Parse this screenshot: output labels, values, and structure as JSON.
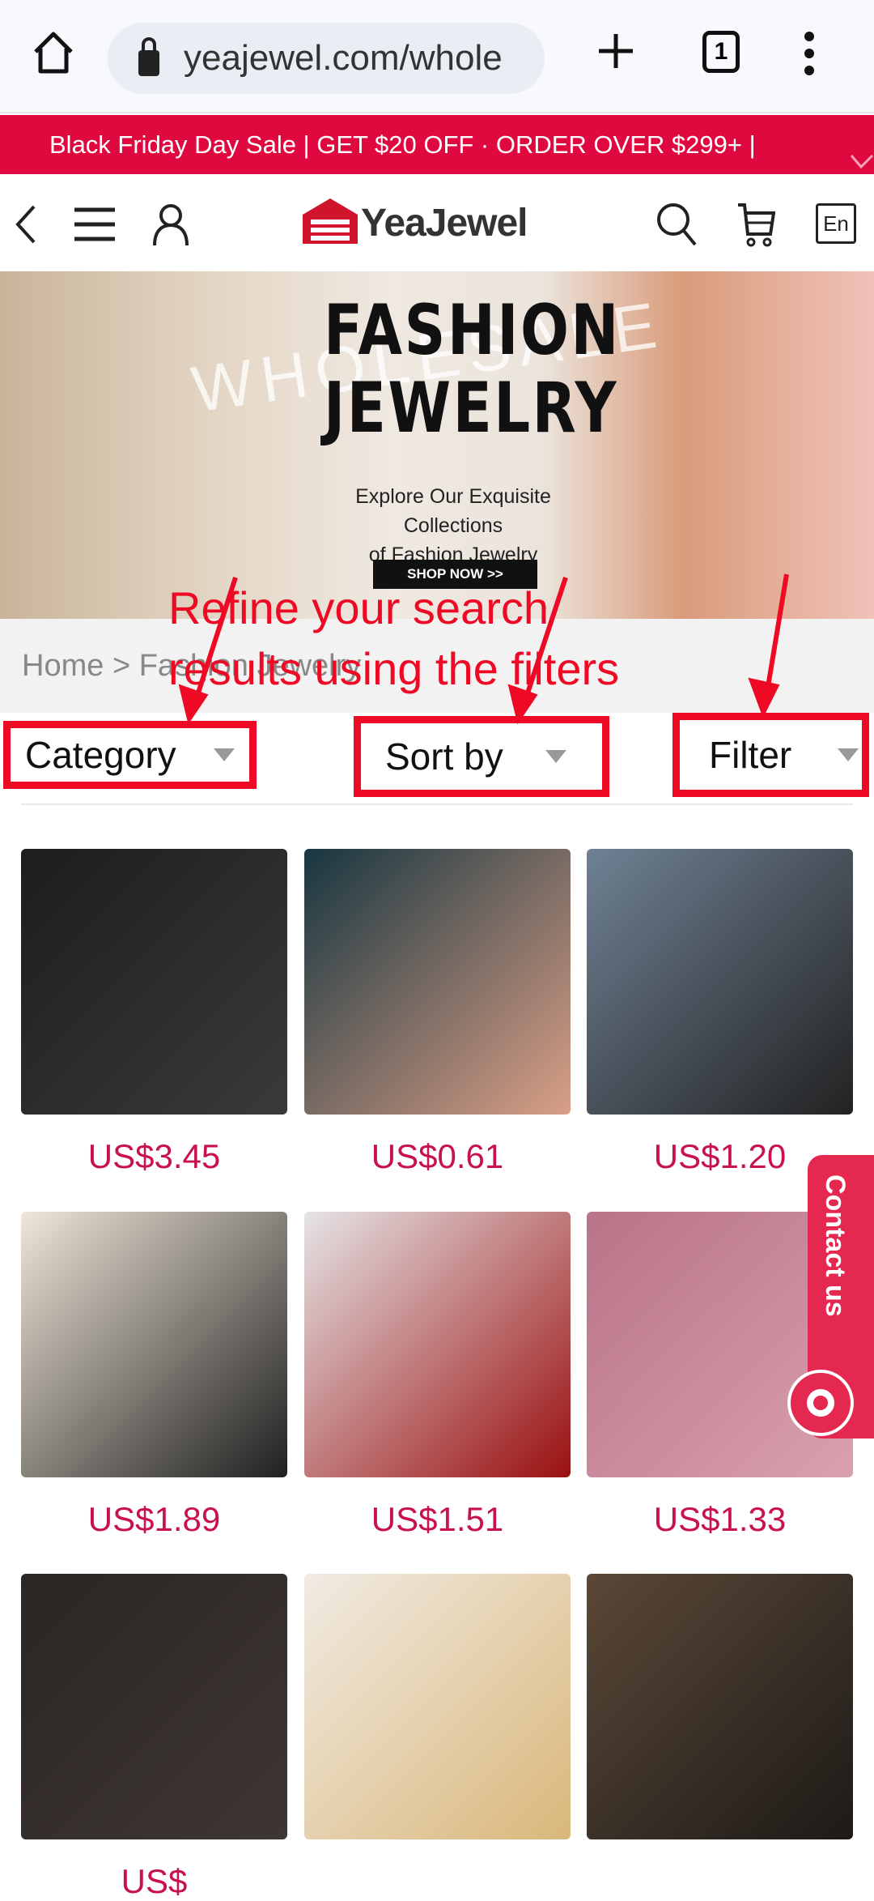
{
  "browser": {
    "url": "yeajewel.com/whole",
    "tab_count": "1"
  },
  "promo": {
    "text": "Black Friday Day Sale | GET $20 OFF  ·  ORDER OVER $299+ |"
  },
  "header": {
    "logo": "YeaJewel",
    "language": "En"
  },
  "hero": {
    "title_line1": "FASHION",
    "title_line2": "JEWELRY",
    "watermark": "WHOLESALE",
    "subtitle_line1": "Explore Our Exquisite Collections",
    "subtitle_line2": "of Fashion Jewelry",
    "button": "SHOP NOW >>"
  },
  "breadcrumb": {
    "home": "Home",
    "separator": ">",
    "current": "Fashion Jewelry"
  },
  "annotation": {
    "line1": "Refine your search",
    "line2": "results using the filters",
    "color": "#ee0a24"
  },
  "filters": {
    "category": "Category",
    "sort": "Sort by",
    "filter": "Filter"
  },
  "products": [
    {
      "price": "US$3.45",
      "colors": [
        "#1d1d1f",
        "#3a3a3c"
      ]
    },
    {
      "price": "US$0.61",
      "colors": [
        "#173640",
        "#d99f86"
      ]
    },
    {
      "price": "US$1.20",
      "colors": [
        "#6f8194",
        "#222"
      ]
    },
    {
      "price": "US$1.89",
      "colors": [
        "#efe6d8",
        "#1f1f1f"
      ]
    },
    {
      "price": "US$1.51",
      "colors": [
        "#e6e4e6",
        "#9a1010"
      ]
    },
    {
      "price": "US$1.33",
      "colors": [
        "#b97488",
        "#d9a0ae"
      ]
    },
    {
      "price": "US$",
      "colors": [
        "#2b2623",
        "#3e3632"
      ]
    },
    {
      "price": "",
      "colors": [
        "#f1ebe3",
        "#d9b77a"
      ]
    },
    {
      "price": "",
      "colors": [
        "#5b4838",
        "#1d1a17"
      ]
    }
  ],
  "contact": {
    "label": "Contact us"
  },
  "brand_color": "#e0093f",
  "price_color": "#c8124f"
}
